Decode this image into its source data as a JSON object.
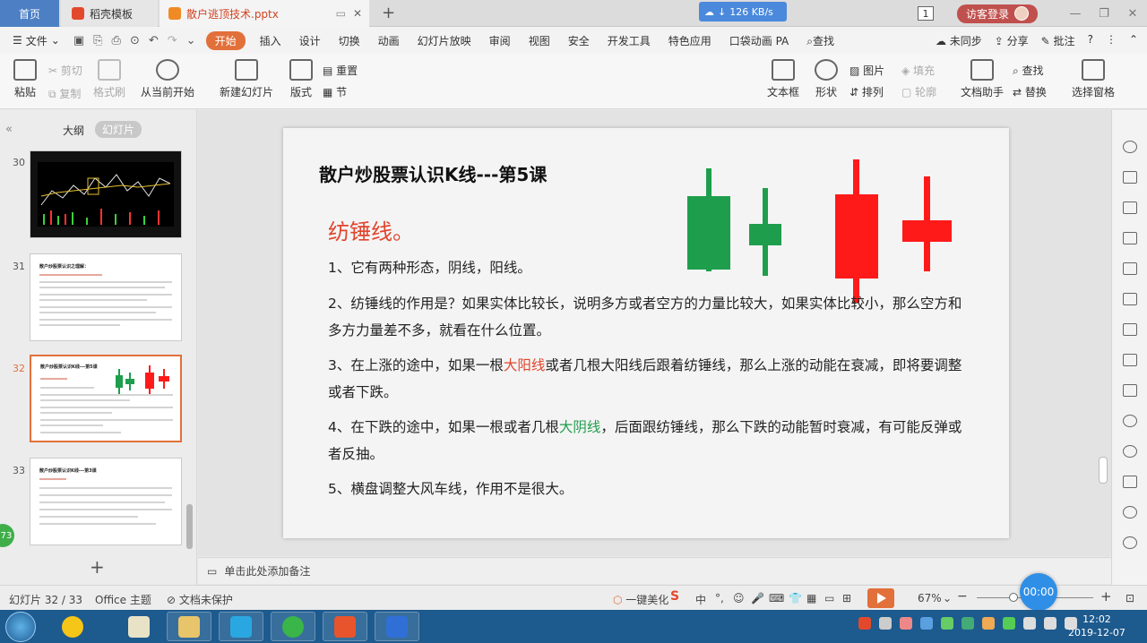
{
  "titlebar": {
    "tabs": [
      {
        "label": "首页"
      },
      {
        "label": "稻壳模板"
      },
      {
        "label": "散户逃顶技术.pptx"
      }
    ],
    "speed": "126 KB/s",
    "window_count": "1",
    "login_label": "访客登录"
  },
  "menu": {
    "file": "文件",
    "items": [
      "开始",
      "插入",
      "设计",
      "切换",
      "动画",
      "幻灯片放映",
      "审阅",
      "视图",
      "安全",
      "开发工具",
      "特色应用",
      "口袋动画 PA",
      "查找"
    ],
    "right": [
      "未同步",
      "分享",
      "批注"
    ]
  },
  "ribbon": {
    "paste": "粘贴",
    "cut": "剪切",
    "copy": "复制",
    "format_painter": "格式刷",
    "from_current": "从当前开始",
    "new_slide": "新建幻灯片",
    "layout": "版式",
    "reset": "重置",
    "section": "节",
    "font_size": "0",
    "textbox": "文本框",
    "shape": "形状",
    "image": "图片",
    "fill": "填充",
    "arrange": "排列",
    "outline": "轮廓",
    "doc_helper": "文档助手",
    "find": "查找",
    "replace": "替换",
    "select_pane": "选择窗格"
  },
  "left_panel": {
    "outline_label": "大纲",
    "slides_label": "幻灯片",
    "thumbs": [
      {
        "num": "30",
        "title": ""
      },
      {
        "num": "31",
        "title": "散户炒股票认识之理解："
      },
      {
        "num": "32",
        "title": "散户炒股票认识K线---第5课"
      },
      {
        "num": "33",
        "title": "散户炒股票认识K线---第3课"
      }
    ],
    "badge": "73"
  },
  "slide": {
    "title": "散户炒股票认识K线---第5课",
    "subtitle": "纺锤线。",
    "p1": "1、它有两种形态，阴线，阳线。",
    "p2": "2、纺锤线的作用是？如果实体比较长，说明多方或者空方的力量比较大，如果实体比较小，那么空方和多方力量差不多，就看在什么位置。",
    "p3_a": "3、在上涨的途中，如果一根",
    "p3_hl": "大阳线",
    "p3_b": "或者几根大阳线后跟着纺锤线，那么上涨的动能在衰减，即将要调整或者下跌。",
    "p4_a": "4、在下跌的途中，如果一根或者几根",
    "p4_hl": "大阴线",
    "p4_b": "，后面跟纺锤线，那么下跌的动能暂时衰减，有可能反弹或者反抽。",
    "p5": "5、横盘调整大风车线，作用不是很大。",
    "colors": {
      "green": "#1e9e4c",
      "red": "#ff1a1a"
    }
  },
  "notes_placeholder": "单击此处添加备注",
  "status": {
    "slide_pos": "幻灯片 32 / 33",
    "theme": "Office 主题",
    "protection": "文档未保护",
    "beautify": "一键美化",
    "zoom": "67%",
    "timer": "00:00"
  },
  "taskbar": {
    "time": "12:02",
    "date": "2019-12-07"
  }
}
